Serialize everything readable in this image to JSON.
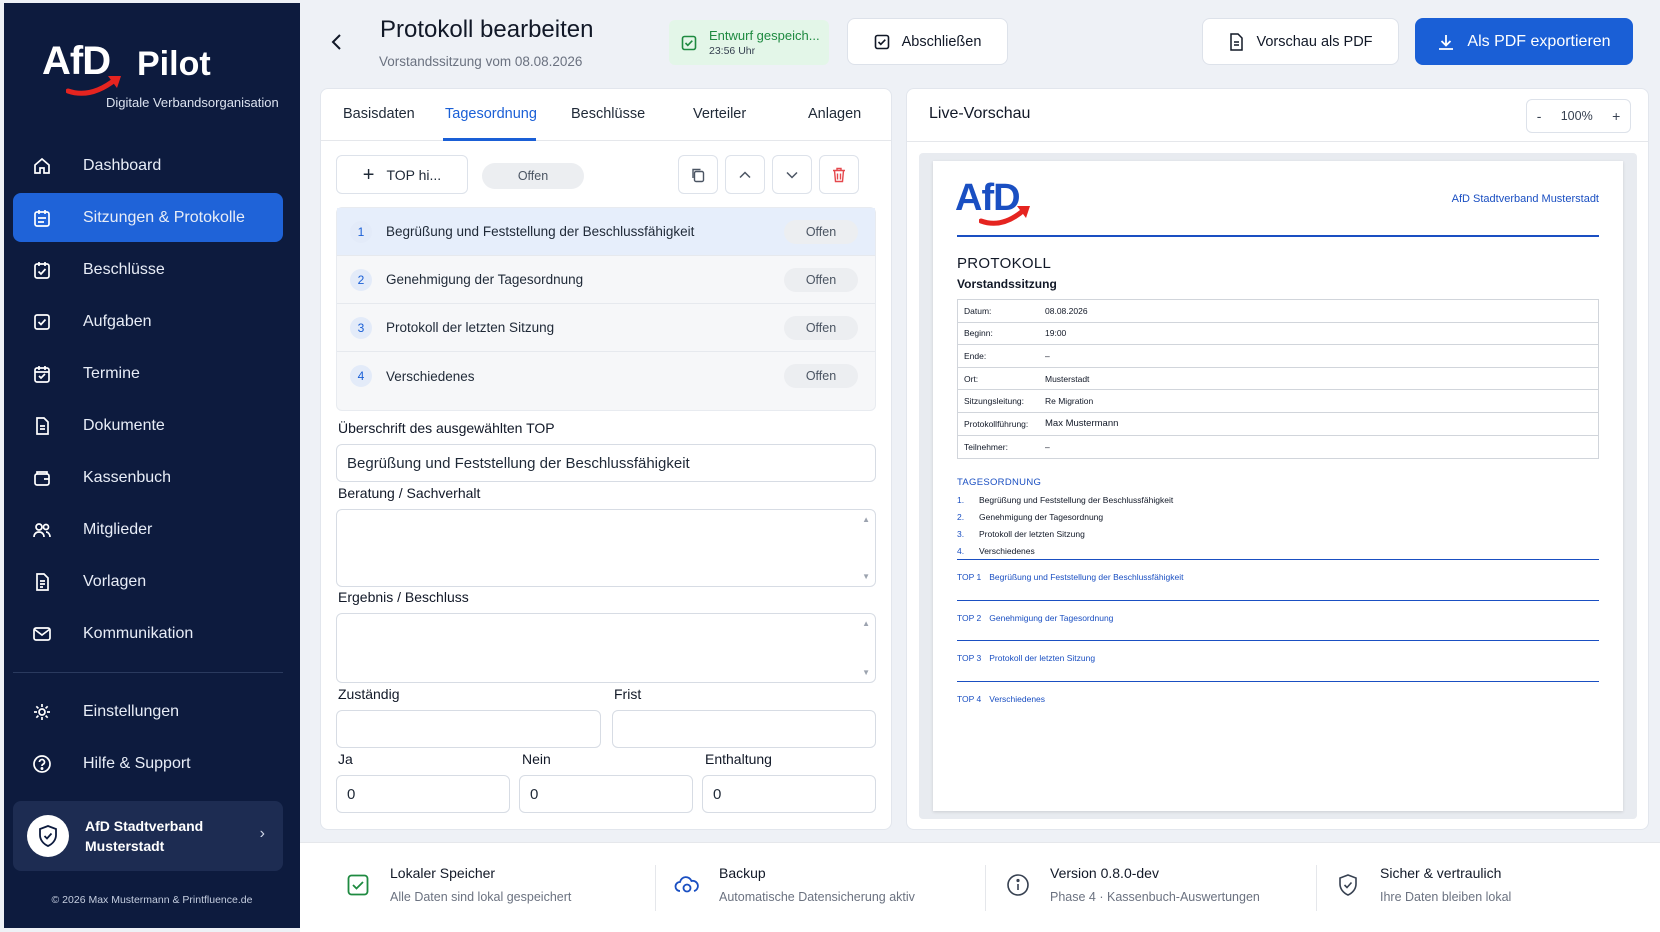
{
  "brand": {
    "logo_mark": "AfD",
    "logo_name": "Pilot",
    "tagline": "Digitale Verbandsorganisation"
  },
  "sidebar": {
    "items": [
      {
        "label": "Dashboard",
        "icon": "home-icon"
      },
      {
        "label": "Sitzungen & Protokolle",
        "icon": "calendar-list-icon"
      },
      {
        "label": "Beschlüsse",
        "icon": "calendar-check-icon"
      },
      {
        "label": "Aufgaben",
        "icon": "checkbox-icon"
      },
      {
        "label": "Termine",
        "icon": "calendar-icon"
      },
      {
        "label": "Dokumente",
        "icon": "document-icon"
      },
      {
        "label": "Kassenbuch",
        "icon": "wallet-icon"
      },
      {
        "label": "Mitglieder",
        "icon": "users-icon"
      },
      {
        "label": "Vorlagen",
        "icon": "template-icon"
      },
      {
        "label": "Kommunikation",
        "icon": "mail-icon"
      }
    ],
    "bottom_items": [
      {
        "label": "Einstellungen",
        "icon": "gear-icon"
      },
      {
        "label": "Hilfe & Support",
        "icon": "help-icon"
      }
    ],
    "org": {
      "line1": "AfD Stadtverband",
      "line2": "Musterstadt"
    },
    "copyright": "© 2026 Max Mustermann & Printfluence.de"
  },
  "header": {
    "title": "Protokoll bearbeiten",
    "subtitle": "Vorstandssitzung vom 08.08.2026",
    "status": {
      "label": "Entwurf gespeich...",
      "time": "23:56 Uhr"
    },
    "finish_label": "Abschließen",
    "preview_pdf_label": "Vorschau als PDF",
    "export_pdf_label": "Als PDF exportieren"
  },
  "editor": {
    "tabs": [
      "Basisdaten",
      "Tagesordnung",
      "Beschlüsse",
      "Verteiler",
      "Anlagen"
    ],
    "active_tab": "Tagesordnung",
    "add_top_label": "TOP hi...",
    "status_filter": "Offen",
    "tops": [
      {
        "num": "1",
        "title": "Begrüßung und Feststellung der Beschlussfähigkeit",
        "status": "Offen"
      },
      {
        "num": "2",
        "title": "Genehmigung der Tagesordnung",
        "status": "Offen"
      },
      {
        "num": "3",
        "title": "Protokoll der letzten Sitzung",
        "status": "Offen"
      },
      {
        "num": "4",
        "title": "Verschiedenes",
        "status": "Offen"
      }
    ],
    "heading_label": "Überschrift des ausgewählten TOP",
    "heading_value": "Begrüßung und Feststellung der Beschlussfähigkeit",
    "beratung_label": "Beratung / Sachverhalt",
    "ergebnis_label": "Ergebnis / Beschluss",
    "zustaendig_label": "Zuständig",
    "frist_label": "Frist",
    "ja_label": "Ja",
    "nein_label": "Nein",
    "enthaltung_label": "Enthaltung",
    "ja_value": "0",
    "nein_value": "0",
    "enthaltung_value": "0"
  },
  "preview": {
    "title": "Live-Vorschau",
    "zoom": "100%",
    "zoom_minus": "-",
    "zoom_plus": "+",
    "doc": {
      "logo": "AfD",
      "org": "AfD Stadtverband Musterstadt",
      "heading": "PROTOKOLL",
      "subheading": "Vorstandssitzung",
      "fields": [
        {
          "k": "Datum:",
          "v": "08.08.2026"
        },
        {
          "k": "Beginn:",
          "v": "19:00"
        },
        {
          "k": "Ende:",
          "v": "–"
        },
        {
          "k": "Ort:",
          "v": "Musterstadt"
        },
        {
          "k": "Sitzungsleitung:",
          "v": "Re Migration"
        },
        {
          "k": "Protokollführung:",
          "v": "Max Mustermann"
        },
        {
          "k": "Teilnehmer:",
          "v": "–"
        }
      ],
      "agenda_heading": "TAGESORDNUNG",
      "agenda": [
        {
          "n": "1.",
          "t": "Begrüßung und Feststellung der Beschlussfähigkeit"
        },
        {
          "n": "2.",
          "t": "Genehmigung der Tagesordnung"
        },
        {
          "n": "3.",
          "t": "Protokoll der letzten Sitzung"
        },
        {
          "n": "4.",
          "t": "Verschiedenes"
        }
      ],
      "tops": [
        {
          "n": "TOP 1",
          "t": "Begrüßung und Feststellung der Beschlussfähigkeit"
        },
        {
          "n": "TOP 2",
          "t": "Genehmigung der Tagesordnung"
        },
        {
          "n": "TOP 3",
          "t": "Protokoll der letzten Sitzung"
        },
        {
          "n": "TOP 4",
          "t": "Verschiedenes"
        }
      ]
    }
  },
  "footer": [
    {
      "title": "Lokaler Speicher",
      "sub": "Alle Daten sind lokal gespeichert",
      "icon": "checkbox-icon"
    },
    {
      "title": "Backup",
      "sub": "Automatische Datensicherung aktiv",
      "icon": "cloud-sync-icon"
    },
    {
      "title": "Version 0.8.0-dev",
      "sub": "Phase 4 · Kassenbuch-Auswertungen",
      "icon": "info-icon"
    },
    {
      "title": "Sicher & vertraulich",
      "sub": "Ihre Daten bleiben lokal",
      "icon": "shield-check-icon"
    }
  ],
  "colors": {
    "sidebar": "#0d1b3e",
    "accent": "#1a5fd6",
    "success": "#1e8a40",
    "danger": "#e5484d"
  }
}
